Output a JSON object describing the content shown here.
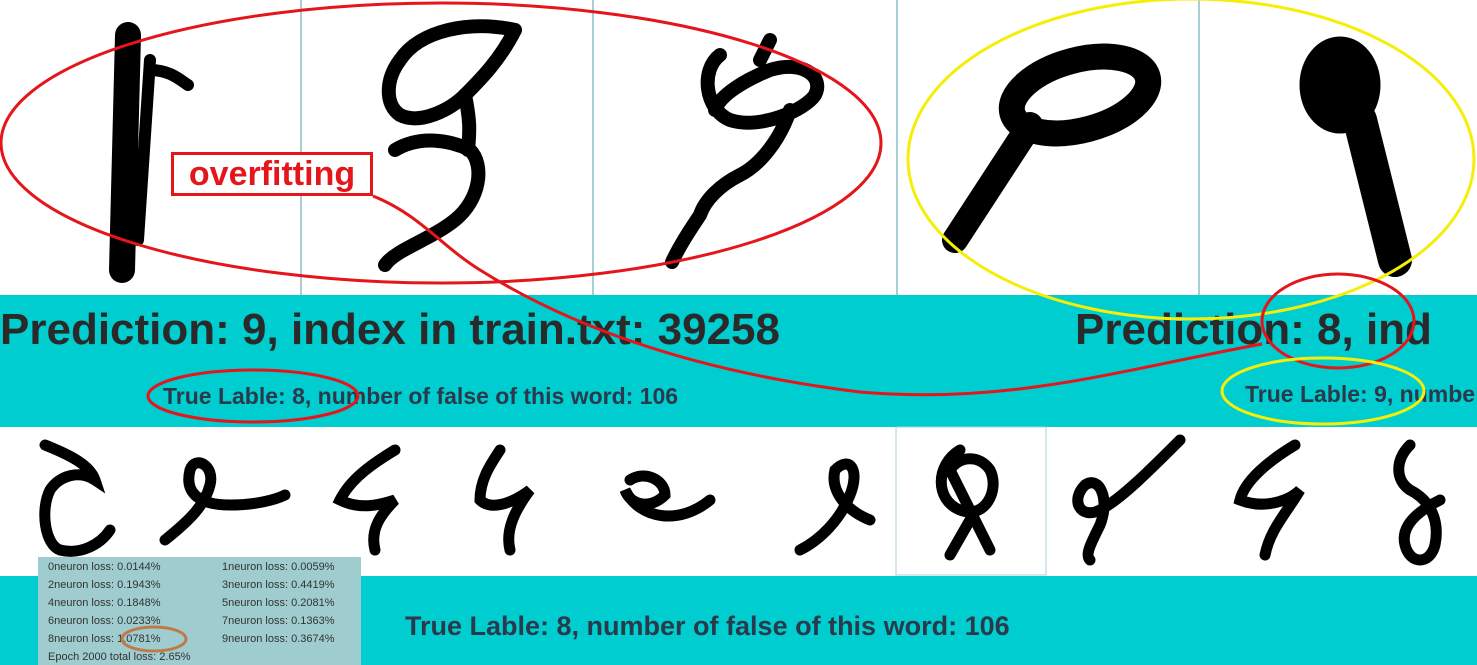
{
  "overlay_label": "overfitting",
  "left_sample": {
    "prediction": "Prediction: 9, index in train.txt: 39258",
    "true_label": "True Lable: 8, number of false of this word: 106"
  },
  "right_sample": {
    "prediction": "Prediction: 8, ind",
    "true_label": "True Lable: 9, numbe"
  },
  "bottom_true_label": "True Lable: 8, number of false of this word: 106",
  "loss_panel": {
    "items": [
      "0neuron loss: 0.0144%",
      "1neuron loss: 0.0059%",
      "2neuron loss: 0.1943%",
      "3neuron loss: 0.4419%",
      "4neuron loss: 0.1848%",
      "5neuron loss: 0.2081%",
      "6neuron loss: 0.0233%",
      "7neuron loss: 0.1363%",
      "8neuron loss: 1.0781%",
      "9neuron loss: 0.3674%"
    ],
    "total": "Epoch 2000 total loss: 2.65%"
  },
  "colors": {
    "band": "#00cdd0",
    "red_annotation": "#e4151b",
    "yellow_annotation": "#f5ee0a",
    "brown_annotation": "#c07a4a",
    "loss_panel_bg": "#9ecccf"
  }
}
